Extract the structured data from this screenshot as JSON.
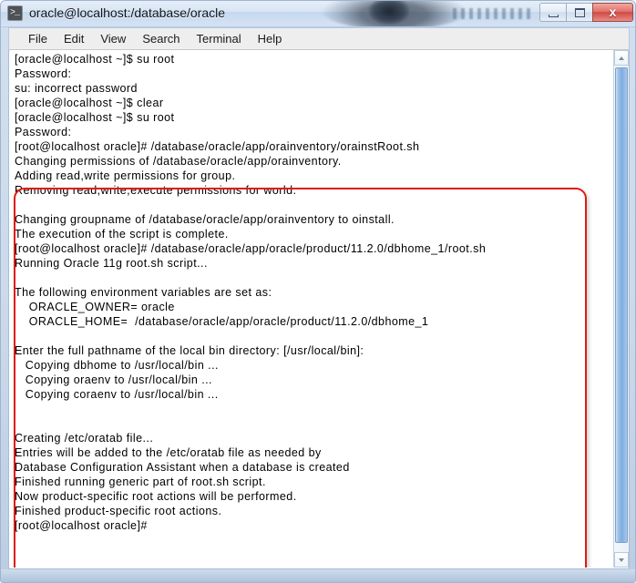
{
  "window": {
    "title": "oracle@localhost:/database/oracle",
    "icon": "terminal-icon",
    "controls": {
      "minimize": "–",
      "maximize": "❐",
      "close": "x"
    }
  },
  "menubar": {
    "items": [
      {
        "label": "File"
      },
      {
        "label": "Edit"
      },
      {
        "label": "View"
      },
      {
        "label": "Search"
      },
      {
        "label": "Terminal"
      },
      {
        "label": "Help"
      }
    ]
  },
  "terminal": {
    "lines_before_highlight": [
      "[oracle@localhost ~]$ su root",
      "Password:",
      "su: incorrect password",
      "[oracle@localhost ~]$ clear",
      "[oracle@localhost ~]$ su root",
      "Password:"
    ],
    "highlighted_lines": [
      "[root@localhost oracle]# /database/oracle/app/orainventory/orainstRoot.sh",
      "Changing permissions of /database/oracle/app/orainventory.",
      "Adding read,write permissions for group.",
      "Removing read,write,execute permissions for world.",
      "",
      "Changing groupname of /database/oracle/app/orainventory to oinstall.",
      "The execution of the script is complete.",
      "[root@localhost oracle]# /database/oracle/app/oracle/product/11.2.0/dbhome_1/root.sh",
      "Running Oracle 11g root.sh script...",
      "",
      "The following environment variables are set as:",
      "    ORACLE_OWNER= oracle",
      "    ORACLE_HOME=  /database/oracle/app/oracle/product/11.2.0/dbhome_1",
      "",
      "Enter the full pathname of the local bin directory: [/usr/local/bin]:",
      "   Copying dbhome to /usr/local/bin ...",
      "   Copying oraenv to /usr/local/bin ...",
      "   Copying coraenv to /usr/local/bin ...",
      "",
      "",
      "Creating /etc/oratab file...",
      "Entries will be added to the /etc/oratab file as needed by",
      "Database Configuration Assistant when a database is created",
      "Finished running generic part of root.sh script.",
      "Now product-specific root actions will be performed.",
      "Finished product-specific root actions.",
      "[root@localhost oracle]#"
    ],
    "highlight_color": "#e01b14"
  },
  "scrollbar": {
    "up_arrow": "▲",
    "down_arrow": "▼"
  }
}
